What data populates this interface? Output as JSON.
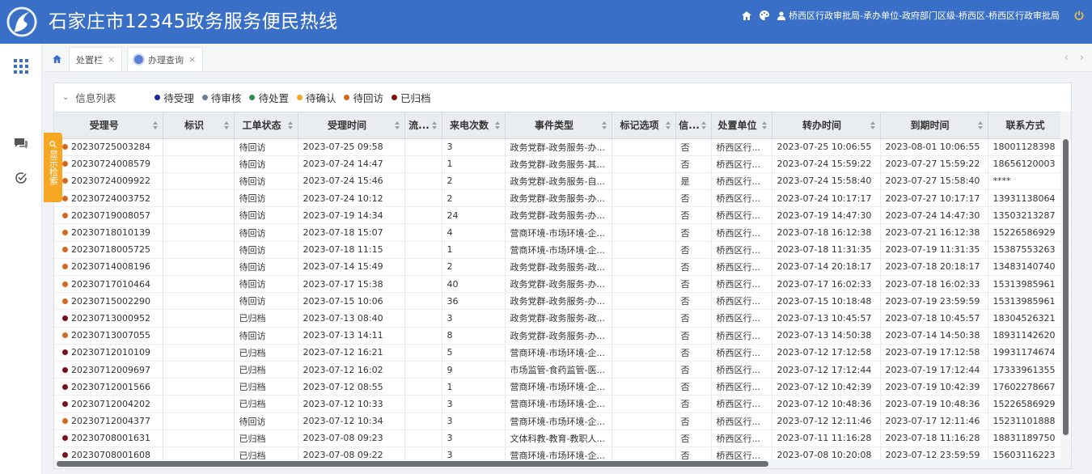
{
  "header": {
    "title": "石家庄市12345政务服务便民热线",
    "user_info": "桥西区行政审批局-承办单位-政府部门区级-桥西区-桥西区行政审批局",
    "brand_color": "#3a6fc7"
  },
  "rail": {
    "icons": [
      "apps-grid-icon",
      "chat-icon",
      "check-circle-icon"
    ]
  },
  "tabs": [
    {
      "label": "处置栏",
      "close": "×"
    },
    {
      "label": "办理查询",
      "close": "×"
    }
  ],
  "search_toggle": {
    "label": "显示检索"
  },
  "panel": {
    "title": "信息列表",
    "legend": [
      {
        "label": "待受理",
        "color": "#1a2a9c"
      },
      {
        "label": "待审核",
        "color": "#6a7f9a"
      },
      {
        "label": "待处置",
        "color": "#2e8b57"
      },
      {
        "label": "待确认",
        "color": "#f5a623"
      },
      {
        "label": "待回访",
        "color": "#d2691e"
      },
      {
        "label": "已归档",
        "color": "#7a0f18"
      }
    ]
  },
  "table": {
    "columns": [
      "受理号",
      "标识",
      "工单状态",
      "受理时间",
      "流...",
      "来电次数",
      "事件类型",
      "标记选项",
      "信...",
      "处置单位",
      "转办时间",
      "到期时间",
      "联系方式"
    ],
    "status_colors": {
      "待回访": "#d2691e",
      "已归档": "#7a0f18"
    },
    "rows": [
      [
        "20230725003284",
        "",
        "待回访",
        "2023-07-25 09:58",
        "",
        "3",
        "政务党群-政务服务-办...",
        "",
        "否",
        "桥西区行...",
        "2023-07-25 10:06:55",
        "2023-08-01 10:06:55",
        "18001128398"
      ],
      [
        "20230724008579",
        "",
        "待回访",
        "2023-07-24 14:47",
        "",
        "1",
        "政务党群-政务服务-其...",
        "",
        "否",
        "桥西区行...",
        "2023-07-24 15:59:22",
        "2023-07-27 15:59:22",
        "18656120003"
      ],
      [
        "20230724009922",
        "",
        "待回访",
        "2023-07-24 15:46",
        "",
        "2",
        "政务党群-政务服务-自...",
        "",
        "是",
        "桥西区行...",
        "2023-07-24 15:58:40",
        "2023-07-27 15:58:40",
        "****"
      ],
      [
        "20230724003752",
        "",
        "待回访",
        "2023-07-24 10:12",
        "",
        "2",
        "政务党群-政务服务-办...",
        "",
        "否",
        "桥西区行...",
        "2023-07-24 10:17:17",
        "2023-07-27 10:17:17",
        "13931138064"
      ],
      [
        "20230719008057",
        "",
        "待回访",
        "2023-07-19 14:34",
        "",
        "24",
        "政务党群-政务服务-办...",
        "",
        "否",
        "桥西区行...",
        "2023-07-19 14:47:30",
        "2023-07-24 14:47:30",
        "13503213287"
      ],
      [
        "20230718010139",
        "",
        "待回访",
        "2023-07-18 15:07",
        "",
        "4",
        "营商环境-市场环境-企...",
        "",
        "否",
        "桥西区行...",
        "2023-07-18 16:12:38",
        "2023-07-21 16:12:38",
        "15226586929"
      ],
      [
        "20230718005725",
        "",
        "待回访",
        "2023-07-18 11:15",
        "",
        "1",
        "营商环境-市场环境-企...",
        "",
        "否",
        "桥西区行...",
        "2023-07-18 11:31:35",
        "2023-07-19 11:31:35",
        "15387553263"
      ],
      [
        "20230714008196",
        "",
        "待回访",
        "2023-07-14 15:49",
        "",
        "2",
        "政务党群-政务服务-政...",
        "",
        "否",
        "桥西区行...",
        "2023-07-14 20:18:17",
        "2023-07-18 20:18:17",
        "13483140740"
      ],
      [
        "20230717010464",
        "",
        "待回访",
        "2023-07-17 15:38",
        "",
        "40",
        "政务党群-政务服务-办...",
        "",
        "否",
        "桥西区行...",
        "2023-07-17 16:02:33",
        "2023-07-18 16:02:33",
        "15313985961"
      ],
      [
        "20230715002290",
        "",
        "待回访",
        "2023-07-15 10:06",
        "",
        "36",
        "政务党群-政务服务-办...",
        "",
        "否",
        "桥西区行...",
        "2023-07-15 10:18:48",
        "2023-07-19 23:59:59",
        "15313985961"
      ],
      [
        "20230713000952",
        "",
        "已归档",
        "2023-07-13 08:40",
        "",
        "3",
        "政务党群-政务服务-政...",
        "",
        "否",
        "桥西区行...",
        "2023-07-13 10:45:57",
        "2023-07-18 10:45:57",
        "18304526321"
      ],
      [
        "20230713007055",
        "",
        "待回访",
        "2023-07-13 14:11",
        "",
        "8",
        "政务党群-政务服务-办...",
        "",
        "否",
        "桥西区行...",
        "2023-07-13 14:50:38",
        "2023-07-14 14:50:38",
        "18931142620"
      ],
      [
        "20230712010109",
        "",
        "已归档",
        "2023-07-12 16:21",
        "",
        "5",
        "营商环境-市场环境-企...",
        "",
        "否",
        "桥西区行...",
        "2023-07-12 17:12:58",
        "2023-07-19 17:12:58",
        "19931174674"
      ],
      [
        "20230712009697",
        "",
        "已归档",
        "2023-07-12 16:02",
        "",
        "9",
        "市场监管-食药监管-医...",
        "",
        "否",
        "桥西区行...",
        "2023-07-12 17:12:44",
        "2023-07-19 17:12:44",
        "17333961355"
      ],
      [
        "20230712001566",
        "",
        "已归档",
        "2023-07-12 08:55",
        "",
        "1",
        "营商环境-市场环境-企...",
        "",
        "否",
        "桥西区行...",
        "2023-07-12 10:42:39",
        "2023-07-19 10:42:39",
        "17602278667"
      ],
      [
        "20230712004202",
        "",
        "已归档",
        "2023-07-12 10:33",
        "",
        "3",
        "营商环境-市场环境-企...",
        "",
        "否",
        "桥西区行...",
        "2023-07-12 10:48:36",
        "2023-07-19 10:48:36",
        "15226586929"
      ],
      [
        "20230712004377",
        "",
        "待回访",
        "2023-07-12 10:34",
        "",
        "3",
        "营商环境-市场环境-企...",
        "",
        "否",
        "桥西区行...",
        "2023-07-12 12:11:46",
        "2023-07-17 12:11:46",
        "15231101888"
      ],
      [
        "20230708001631",
        "",
        "已归档",
        "2023-07-08 09:23",
        "",
        "3",
        "文体科教-教育-教职人...",
        "",
        "否",
        "桥西区行...",
        "2023-07-11 11:16:28",
        "2023-07-18 11:16:28",
        "18831189750"
      ],
      [
        "20230708001608",
        "",
        "已归档",
        "2023-07-08 09:22",
        "",
        "3",
        "营商环境-市场环境-企...",
        "",
        "否",
        "桥西区行...",
        "2023-07-08 10:20:08",
        "2023-07-12 23:59:59",
        "15603116223"
      ]
    ]
  }
}
